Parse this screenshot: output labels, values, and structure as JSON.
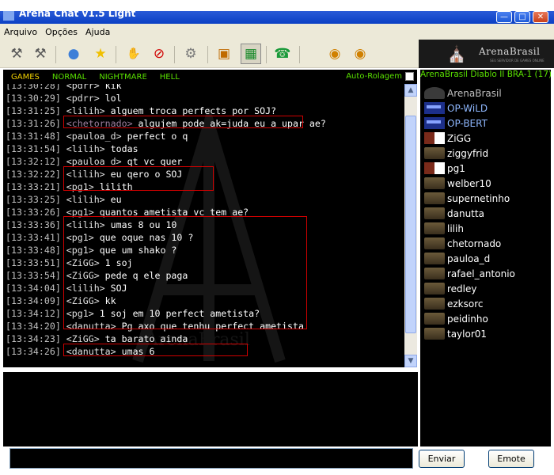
{
  "window": {
    "title": "Arena Chat v1.5 Light"
  },
  "menu": [
    "Arquivo",
    "Opções",
    "Ajuda"
  ],
  "toolbar_icons": [
    "wrench-icon",
    "tools-icon",
    "chat-bubble-icon",
    "star-icon",
    "hand-icon",
    "ban-icon",
    "gear-icon",
    "book-icon",
    "image-icon",
    "phone-icon",
    "cd-icon",
    "cd-alt-icon"
  ],
  "brand": {
    "name": "ArenaBrasil",
    "subtitle": "SEU SERVIDOR DE GAMES ONLINE"
  },
  "modes": [
    {
      "label": "GAMES",
      "selected": true
    },
    {
      "label": "NORMAL",
      "selected": false
    },
    {
      "label": "NIGHTMARE",
      "selected": false
    },
    {
      "label": "HELL",
      "selected": false
    }
  ],
  "auto_rolagem": {
    "label": "Auto-Rolagem",
    "checked": false
  },
  "chat": {
    "watermark": "ArenaBrasil",
    "lines": [
      {
        "ts": "[13:30:28]",
        "nick": "<pdrr>",
        "nick_class": "",
        "msg": "kik"
      },
      {
        "ts": "[13:30:29]",
        "nick": "<pdrr>",
        "nick_class": "",
        "msg": "lol"
      },
      {
        "ts": "[13:31:25]",
        "nick": "<lilih>",
        "nick_class": "",
        "msg": "alguem troca perfects por SOJ?"
      },
      {
        "ts": "[13:31:26]",
        "nick": "<chetornado>",
        "nick_class": "chetornado",
        "msg": "algujem pode ak=juda eu a upar ae?"
      },
      {
        "ts": "[13:31:48]",
        "nick": "<pauloa_d>",
        "nick_class": "",
        "msg": "perfect o q"
      },
      {
        "ts": "[13:31:54]",
        "nick": "<lilih>",
        "nick_class": "",
        "msg": "todas"
      },
      {
        "ts": "[13:32:12]",
        "nick": "<pauloa_d>",
        "nick_class": "",
        "msg": "qt vc quer"
      },
      {
        "ts": "[13:32:22]",
        "nick": "<lilih>",
        "nick_class": "",
        "msg": "eu qero o SOJ"
      },
      {
        "ts": "[13:33:21]",
        "nick": "<pg1>",
        "nick_class": "",
        "msg": "lilith"
      },
      {
        "ts": "[13:33:25]",
        "nick": "<lilih>",
        "nick_class": "",
        "msg": "eu"
      },
      {
        "ts": "[13:33:26]",
        "nick": "<pg1>",
        "nick_class": "",
        "msg": "quantos ametista vc tem ae?"
      },
      {
        "ts": "[13:33:36]",
        "nick": "<lilih>",
        "nick_class": "",
        "msg": "umas 8 ou 10"
      },
      {
        "ts": "[13:33:41]",
        "nick": "<pg1>",
        "nick_class": "",
        "msg": "que oque nas 10 ?"
      },
      {
        "ts": "[13:33:48]",
        "nick": "<pg1>",
        "nick_class": "",
        "msg": "que um shako ?"
      },
      {
        "ts": "[13:33:51]",
        "nick": "<ZiGG>",
        "nick_class": "zigg",
        "msg": "1 soj"
      },
      {
        "ts": "[13:33:54]",
        "nick": "<ZiGG>",
        "nick_class": "zigg",
        "msg": "pede q ele paga"
      },
      {
        "ts": "[13:34:04]",
        "nick": "<lilih>",
        "nick_class": "",
        "msg": "SOJ"
      },
      {
        "ts": "[13:34:09]",
        "nick": "<ZiGG>",
        "nick_class": "zigg",
        "msg": "kk"
      },
      {
        "ts": "[13:34:12]",
        "nick": "<pg1>",
        "nick_class": "",
        "msg": "1 soj em 10 perfect ametista?"
      },
      {
        "ts": "[13:34:20]",
        "nick": "<danutta>",
        "nick_class": "",
        "msg": "Pg axo que tenhu perfect ametista"
      },
      {
        "ts": "[13:34:23]",
        "nick": "<ZiGG>",
        "nick_class": "zigg",
        "msg": "ta barato ainda"
      },
      {
        "ts": "[13:34:26]",
        "nick": "<danutta>",
        "nick_class": "",
        "msg": "umas 6"
      }
    ]
  },
  "channel": {
    "label": "ArenaBrasil Diablo II BRA-1 (17)"
  },
  "users": [
    {
      "name": "ArenaBrasil",
      "icon": "admin",
      "color": "#c0c0c0"
    },
    {
      "name": "OP-WiLD",
      "icon": "op",
      "color": "#8fb8ff"
    },
    {
      "name": "OP-BERT",
      "icon": "op",
      "color": "#8fb8ff"
    },
    {
      "name": "ZiGG",
      "icon": "mix",
      "color": "#ffffff"
    },
    {
      "name": "ziggyfrid",
      "icon": "class",
      "color": "#ffffff"
    },
    {
      "name": "pg1",
      "icon": "mix",
      "color": "#ffffff"
    },
    {
      "name": "welber10",
      "icon": "class",
      "color": "#ffffff"
    },
    {
      "name": "supernetinho",
      "icon": "class",
      "color": "#ffffff"
    },
    {
      "name": "danutta",
      "icon": "class",
      "color": "#ffffff"
    },
    {
      "name": "lilih",
      "icon": "class",
      "color": "#ffffff"
    },
    {
      "name": "chetornado",
      "icon": "class",
      "color": "#ffffff"
    },
    {
      "name": "pauloa_d",
      "icon": "class",
      "color": "#ffffff"
    },
    {
      "name": "rafael_antonio",
      "icon": "class",
      "color": "#ffffff"
    },
    {
      "name": "redley",
      "icon": "class",
      "color": "#ffffff"
    },
    {
      "name": "ezksorc",
      "icon": "class",
      "color": "#ffffff"
    },
    {
      "name": "peidinho",
      "icon": "class",
      "color": "#ffffff"
    },
    {
      "name": "taylor01",
      "icon": "class",
      "color": "#ffffff"
    }
  ],
  "input": {
    "value": "",
    "placeholder": ""
  },
  "buttons": {
    "send": "Enviar",
    "emote": "Emote"
  }
}
